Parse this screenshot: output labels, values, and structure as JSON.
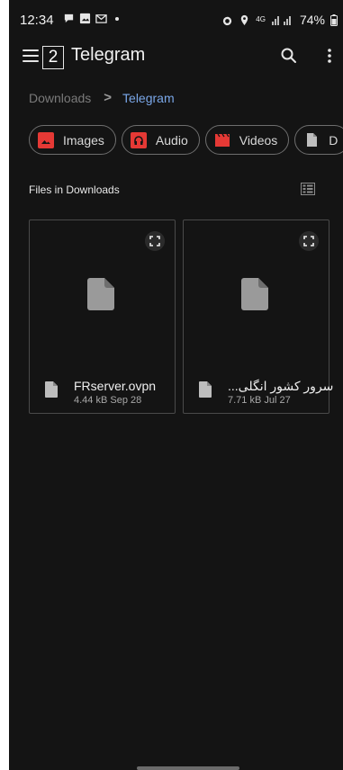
{
  "status_bar": {
    "time": "12:34",
    "battery": "74%",
    "network": "4G"
  },
  "app_bar": {
    "badge_number": "2",
    "title": "Telegram"
  },
  "breadcrumb": {
    "root": "Downloads",
    "current": "Telegram"
  },
  "filter_chips": [
    {
      "label": "Images",
      "icon": "image-icon"
    },
    {
      "label": "Audio",
      "icon": "audio-icon"
    },
    {
      "label": "Videos",
      "icon": "video-icon"
    },
    {
      "label": "D",
      "icon": "document-icon"
    }
  ],
  "section": {
    "title": "Files in Downloads"
  },
  "files": [
    {
      "name": "FRserver.ovpn",
      "meta": "4.44 kB Sep 28"
    },
    {
      "name": "سرور کشور انگلی...",
      "meta": "7.71 kB Jul 27"
    }
  ],
  "colors": {
    "background": "#141414",
    "accent": "#7aa7e8",
    "chip_icon_red": "#e53935"
  }
}
